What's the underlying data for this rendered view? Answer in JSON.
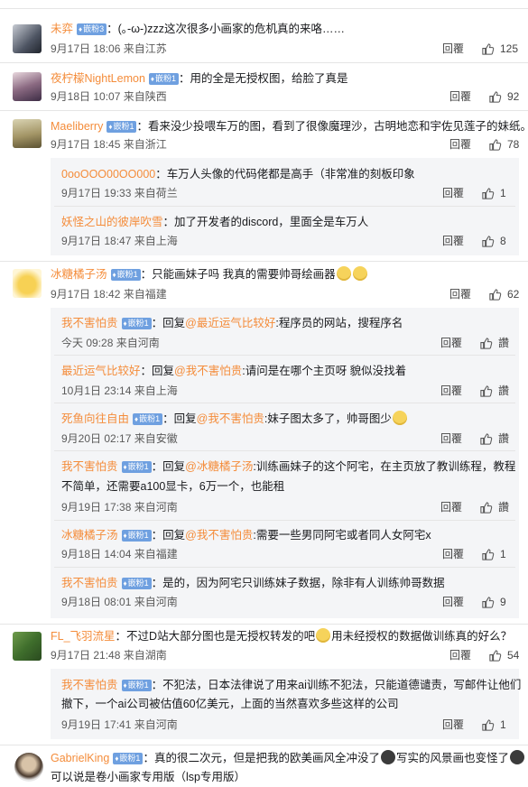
{
  "comments": [
    {
      "user": "未弈",
      "badge": "嵌粉3",
      "text": "：(｡-ω-)zzz这次很多小画家的危机真的来咯……",
      "date": "9月17日 18:06 来自江苏",
      "reply": "回覆",
      "likes": "125"
    },
    {
      "user": "夜柠檬NightLemon",
      "badge": "嵌粉1",
      "text": "：用的全是无授权图，给脸了真是",
      "date": "9月18日 10:07 来自陕西",
      "reply": "回覆",
      "likes": "92"
    },
    {
      "user": "Maeliberry",
      "badge": "嵌粉1",
      "text": "：看来没少投喂车万的图，看到了很像魔理沙，古明地恋和宇佐见莲子的妹纸。",
      "date": "9月17日 18:45 来自浙江",
      "reply": "回覆",
      "likes": "78"
    },
    {
      "user": "0ooOOO00OO000",
      "text": "：车万人头像的代码佬都是高手（非常准的刻板印象",
      "date": "9月17日 19:33 来自荷兰",
      "reply": "回覆",
      "likes": "1"
    },
    {
      "user": "妖怪之山的彼岸吹雪",
      "text": "：加了开发者的discord，里面全是车万人",
      "date": "9月17日 18:47 来自上海",
      "reply": "回覆",
      "likes": "8"
    },
    {
      "user": "冰糖橘子汤",
      "badge": "嵌粉1",
      "text": "：只能画妹子吗 我真的需要帅哥绘画器",
      "date": "9月17日 18:42 来自福建",
      "reply": "回覆",
      "likes": "62"
    },
    {
      "user": "我不害怕贵",
      "badge": "嵌粉1",
      "pre": "：回复",
      "mention": "@最近运气比较好",
      "text": ":程序员的网站，搜程序名",
      "date": "今天 09:28 来自河南",
      "reply": "回覆",
      "likes": "讚"
    },
    {
      "user": "最近运气比较好",
      "pre": "：回复",
      "mention": "@我不害怕贵",
      "text": ":请问是在哪个主页呀 貌似没找着",
      "date": "10月1日 23:14 来自上海",
      "reply": "回覆",
      "likes": "讚"
    },
    {
      "user": "死鱼向往自由",
      "badge": "嵌粉1",
      "pre": "：回复",
      "mention": "@我不害怕贵",
      "text": ":妹子图太多了，帅哥图少",
      "date": "9月20日 02:17 来自安徽",
      "reply": "回覆",
      "likes": "讚"
    },
    {
      "user": "我不害怕贵",
      "badge": "嵌粉1",
      "pre": "：回复",
      "mention": "@冰糖橘子汤",
      "text": ":训练画妹子的这个阿宅，在主页放了教训练程，教程",
      "text2": "不简单，还需要a100显卡，6万一个，也能租",
      "date": "9月19日 17:38 来自河南",
      "reply": "回覆",
      "likes": "讚"
    },
    {
      "user": "冰糖橘子汤",
      "badge": "嵌粉1",
      "pre": "：回复",
      "mention": "@我不害怕贵",
      "text": ":需要一些男同阿宅或者同人女阿宅x",
      "date": "9月18日 14:04 来自福建",
      "reply": "回覆",
      "likes": "1"
    },
    {
      "user": "我不害怕贵",
      "badge": "嵌粉1",
      "text": "：是的，因为阿宅只训练妹子数据，除非有人训练帅哥数据",
      "date": "9月18日 08:01 来自河南",
      "reply": "回覆",
      "likes": "9"
    },
    {
      "user": "FL_飞羽流星",
      "text": "：不过D站大部分图也是无授权转发的吧",
      "text2": "用未经授权的数据做训练真的好么？",
      "date": "9月17日 21:48 来自湖南",
      "reply": "回覆",
      "likes": "54"
    },
    {
      "user": "我不害怕贵",
      "badge": "嵌粉1",
      "text": "：不犯法，日本法律说了用来ai训练不犯法，只能道德谴责，写邮件让他们",
      "text2": "撤下，一个ai公司被估值60亿美元，上面的当然喜欢多些这样的公司",
      "date": "9月19日 17:41 来自河南",
      "reply": "回覆",
      "likes": "1"
    },
    {
      "user": "GabrielKing",
      "badge": "嵌粉1",
      "text": "：真的很二次元，但是把我的欧美画风全冲没了",
      "text2": "写实的风景画也变怪了",
      "text3": "可以说是卷小画家专用版（lsp专用版）"
    }
  ],
  "icons": {
    "like": "thumbs-up-icon",
    "badge": "fan-badge-icon"
  },
  "colors": {
    "username": "#f48c3a",
    "badge": "#6fa0e0",
    "subbg": "#f4f5f7"
  }
}
